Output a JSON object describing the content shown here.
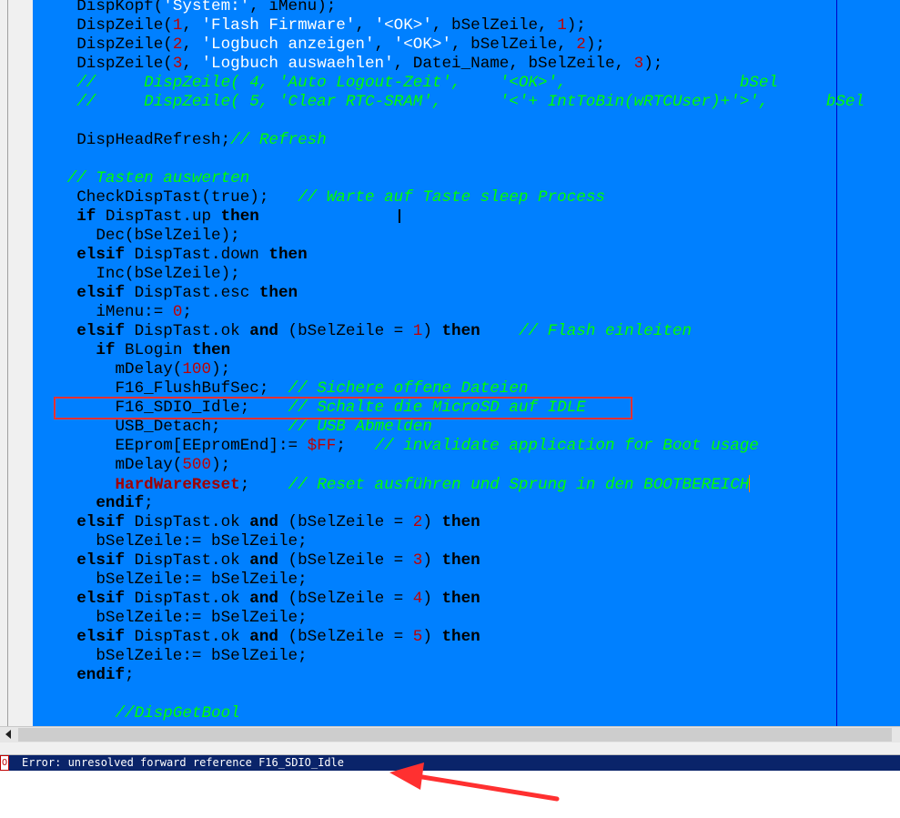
{
  "editor": {
    "lines": [
      [
        {
          "t": "    DispKopf("
        },
        {
          "t": "'System:'",
          "c": "s"
        },
        {
          "t": ", iMenu);"
        }
      ],
      [
        {
          "t": "    DispZeile("
        },
        {
          "t": "1",
          "c": "n"
        },
        {
          "t": ", "
        },
        {
          "t": "'Flash Firmware'",
          "c": "s"
        },
        {
          "t": ", "
        },
        {
          "t": "'<OK>'",
          "c": "s"
        },
        {
          "t": ", bSelZeile, "
        },
        {
          "t": "1",
          "c": "n"
        },
        {
          "t": ");"
        }
      ],
      [
        {
          "t": "    DispZeile("
        },
        {
          "t": "2",
          "c": "n"
        },
        {
          "t": ", "
        },
        {
          "t": "'Logbuch anzeigen'",
          "c": "s"
        },
        {
          "t": ", "
        },
        {
          "t": "'<OK>'",
          "c": "s"
        },
        {
          "t": ", bSelZeile, "
        },
        {
          "t": "2",
          "c": "n"
        },
        {
          "t": ");"
        }
      ],
      [
        {
          "t": "    DispZeile("
        },
        {
          "t": "3",
          "c": "n"
        },
        {
          "t": ", "
        },
        {
          "t": "'Logbuch auswaehlen'",
          "c": "s"
        },
        {
          "t": ", Datei_Name, bSelZeile, "
        },
        {
          "t": "3",
          "c": "n"
        },
        {
          "t": ");"
        }
      ],
      [
        {
          "t": "    //     DispZeile( 4, 'Auto Logout-Zeit',    '<OK>',                  bSel",
          "c": "c"
        }
      ],
      [
        {
          "t": "    //     DispZeile( 5, 'Clear RTC-SRAM',      '<'+ IntToBin(wRTCUser)+'>',      bSel",
          "c": "c"
        }
      ],
      [],
      [
        {
          "t": "    DispHeadRefresh;"
        },
        {
          "t": "// Refresh",
          "c": "c"
        }
      ],
      [],
      [
        {
          "t": "   // Tasten auswerten",
          "c": "c"
        }
      ],
      [
        {
          "t": "    CheckDispTast(true);   "
        },
        {
          "t": "// Warte auf Taste sleep Process",
          "c": "c"
        }
      ],
      [
        {
          "t": "    "
        },
        {
          "t": "if",
          "c": "k"
        },
        {
          "t": " DispTast.up "
        },
        {
          "t": "then",
          "c": "k"
        }
      ],
      [
        {
          "t": "      Dec(bSelZeile);"
        }
      ],
      [
        {
          "t": "    "
        },
        {
          "t": "elsif",
          "c": "k"
        },
        {
          "t": " DispTast.down "
        },
        {
          "t": "then",
          "c": "k"
        }
      ],
      [
        {
          "t": "      Inc(bSelZeile);"
        }
      ],
      [
        {
          "t": "    "
        },
        {
          "t": "elsif",
          "c": "k"
        },
        {
          "t": " DispTast.esc "
        },
        {
          "t": "then",
          "c": "k"
        }
      ],
      [
        {
          "t": "      iMenu:= "
        },
        {
          "t": "0",
          "c": "n"
        },
        {
          "t": ";"
        }
      ],
      [
        {
          "t": "    "
        },
        {
          "t": "elsif",
          "c": "k"
        },
        {
          "t": " DispTast.ok "
        },
        {
          "t": "and",
          "c": "k"
        },
        {
          "t": " (bSelZeile = "
        },
        {
          "t": "1",
          "c": "n"
        },
        {
          "t": ") "
        },
        {
          "t": "then",
          "c": "k"
        },
        {
          "t": "    "
        },
        {
          "t": "// Flash einleiten",
          "c": "c"
        }
      ],
      [
        {
          "t": "      "
        },
        {
          "t": "if",
          "c": "k"
        },
        {
          "t": " BLogin "
        },
        {
          "t": "then",
          "c": "k"
        }
      ],
      [
        {
          "t": "        mDelay("
        },
        {
          "t": "100",
          "c": "n"
        },
        {
          "t": ");"
        }
      ],
      [
        {
          "t": "        F16_FlushBufSec;  "
        },
        {
          "t": "// Sichere offene Dateien",
          "c": "c"
        }
      ],
      [
        {
          "t": "        F16_SDIO_Idle;    "
        },
        {
          "t": "// Schalte die MicroSD auf IDLE",
          "c": "c"
        }
      ],
      [
        {
          "t": "        USB_Detach;       "
        },
        {
          "t": "// USB Abmelden",
          "c": "c"
        }
      ],
      [
        {
          "t": "        EEprom[EEpromEnd]:= "
        },
        {
          "t": "$FF",
          "c": "n"
        },
        {
          "t": ";   "
        },
        {
          "t": "// invalidate application for Boot usage",
          "c": "c"
        }
      ],
      [
        {
          "t": "        mDelay("
        },
        {
          "t": "500",
          "c": "n"
        },
        {
          "t": ");"
        }
      ],
      [
        {
          "t": "        "
        },
        {
          "t": "HardWareReset",
          "c": "h"
        },
        {
          "t": ";    "
        },
        {
          "t": "// Reset ausführen und Sprung in den BOOTBEREICH",
          "c": "c"
        },
        {
          "t": "",
          "cursor": true
        }
      ],
      [
        {
          "t": "      "
        },
        {
          "t": "endif",
          "c": "k"
        },
        {
          "t": ";"
        }
      ],
      [
        {
          "t": "    "
        },
        {
          "t": "elsif",
          "c": "k"
        },
        {
          "t": " DispTast.ok "
        },
        {
          "t": "and",
          "c": "k"
        },
        {
          "t": " (bSelZeile = "
        },
        {
          "t": "2",
          "c": "n"
        },
        {
          "t": ") "
        },
        {
          "t": "then",
          "c": "k"
        }
      ],
      [
        {
          "t": "      bSelZeile:= bSelZeile;"
        }
      ],
      [
        {
          "t": "    "
        },
        {
          "t": "elsif",
          "c": "k"
        },
        {
          "t": " DispTast.ok "
        },
        {
          "t": "and",
          "c": "k"
        },
        {
          "t": " (bSelZeile = "
        },
        {
          "t": "3",
          "c": "n"
        },
        {
          "t": ") "
        },
        {
          "t": "then",
          "c": "k"
        }
      ],
      [
        {
          "t": "      bSelZeile:= bSelZeile;"
        }
      ],
      [
        {
          "t": "    "
        },
        {
          "t": "elsif",
          "c": "k"
        },
        {
          "t": " DispTast.ok "
        },
        {
          "t": "and",
          "c": "k"
        },
        {
          "t": " (bSelZeile = "
        },
        {
          "t": "4",
          "c": "n"
        },
        {
          "t": ") "
        },
        {
          "t": "then",
          "c": "k"
        }
      ],
      [
        {
          "t": "      bSelZeile:= bSelZeile;"
        }
      ],
      [
        {
          "t": "    "
        },
        {
          "t": "elsif",
          "c": "k"
        },
        {
          "t": " DispTast.ok "
        },
        {
          "t": "and",
          "c": "k"
        },
        {
          "t": " (bSelZeile = "
        },
        {
          "t": "5",
          "c": "n"
        },
        {
          "t": ") "
        },
        {
          "t": "then",
          "c": "k"
        }
      ],
      [
        {
          "t": "      bSelZeile:= bSelZeile;"
        }
      ],
      [
        {
          "t": "    "
        },
        {
          "t": "endif",
          "c": "k"
        },
        {
          "t": ";"
        }
      ],
      [],
      [
        {
          "t": "        //DispGetBool",
          "c": "c"
        }
      ]
    ]
  },
  "messages": {
    "marker": "0",
    "error_text": "Error: unresolved forward reference F16_SDIO_Idle"
  },
  "colors": {
    "editor_bg": "#0080ff",
    "comment": "#00ff00",
    "string": "#ffffff",
    "number": "#c00000",
    "highlight_box": "#ff3030",
    "arrow": "#ff3030",
    "error_bar": "#0a246a"
  },
  "icons": {
    "text_cursor": "ibeam-cursor-icon",
    "scroll_left": "scroll-left-arrow-icon",
    "annotation_arrow": "red-arrow-icon"
  }
}
